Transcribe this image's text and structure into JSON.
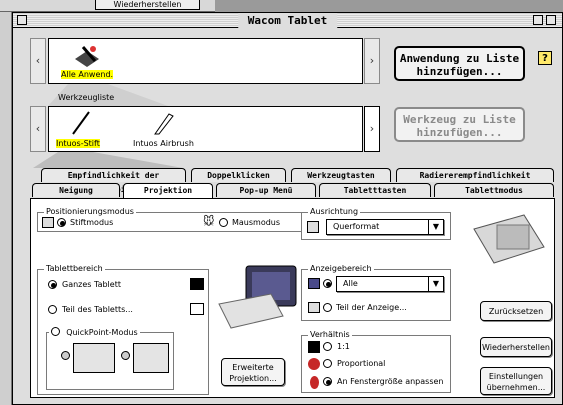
{
  "background": {
    "restore_button": "Wiederherstellen"
  },
  "window": {
    "title": "Wacom Tablet"
  },
  "apps": {
    "item_label": "Alle Anwend.",
    "add_button": "Anwendung zu Liste\nhinzufügen...",
    "help": "?"
  },
  "tools": {
    "section_label": "Werkzeugliste",
    "items": [
      "Intuos-Stift",
      "Intuos Airbrush"
    ],
    "add_button": "Werkzeug zu Liste\nhinzufügen..."
  },
  "tabs": {
    "row1": [
      "Empfindlichkeit der Stiftspitze",
      "Doppelklicken",
      "Werkzeugtasten",
      "Radiererempfindlichkeit"
    ],
    "row2": [
      "Neigung",
      "Projektion",
      "Pop-up Menü",
      "Tabletttasten",
      "Tablettmodus"
    ]
  },
  "positioning": {
    "title": "Positionierungsmodus",
    "stylus_mode": "Stiftmodus",
    "mouse_mode": "Mausmodus"
  },
  "orientation": {
    "title": "Ausrichtung",
    "value": "Querformat"
  },
  "tablet_area": {
    "title": "Tablettbereich",
    "whole": "Ganzes Tablett",
    "part": "Teil des Tabletts...",
    "quickpoint": "QuickPoint-Modus"
  },
  "display_area": {
    "title": "Anzeigebereich",
    "value": "Alle",
    "part": "Teil der Anzeige..."
  },
  "ratio": {
    "title": "Verhältnis",
    "one_to_one": "1:1",
    "proportional": "Proportional",
    "fit_window": "An Fenstergröße anpassen"
  },
  "buttons": {
    "advanced": "Erweiterte\nProjektion...",
    "reset": "Zurücksetzen",
    "restore": "Wiederherstellen",
    "take_settings": "Einstellungen\nübernehmen..."
  },
  "colors": {
    "highlight": "#ffff00",
    "window_bg": "#dedede"
  }
}
